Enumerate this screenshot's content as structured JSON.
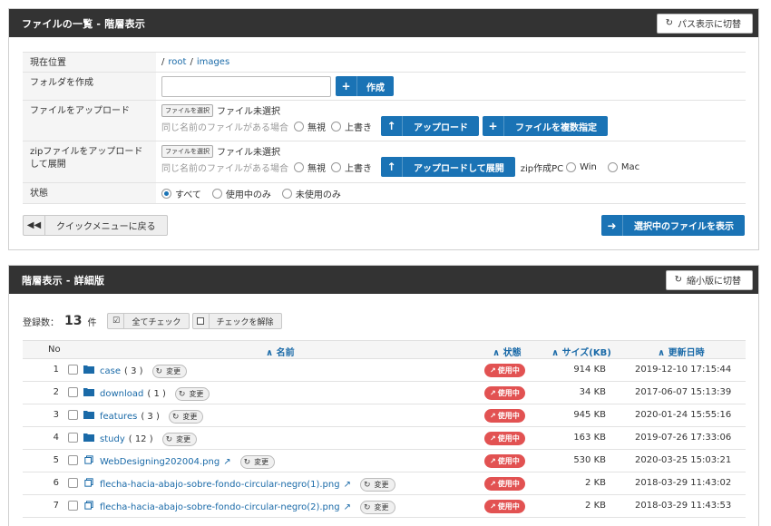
{
  "panel1": {
    "title": "ファイルの一覧 - 階層表示",
    "switch_label": "パス表示に切替",
    "rows": {
      "location_label": "現在位置",
      "location_root": "root",
      "location_sep": "/",
      "location_dir": "images",
      "folder_label": "フォルダを作成",
      "folder_create": "作成",
      "upload_label": "ファイルをアップロード",
      "file_select": "ファイルを選択",
      "file_none": "ファイル未選択",
      "same_name": "同じ名前のファイルがある場合",
      "ignore": "無視",
      "overwrite": "上書き",
      "upload_btn": "アップロード",
      "multi_btn": "ファイルを複数指定",
      "zip_label": "zipファイルをアップロードして展開",
      "zip_btn": "アップロードして展開",
      "zip_pc": "zip作成PC",
      "win": "Win",
      "mac": "Mac",
      "state_label": "状態",
      "state_all": "すべて",
      "state_used": "使用中のみ",
      "state_unused": "未使用のみ"
    },
    "back_btn": "クイックメニューに戻る",
    "show_selected_btn": "選択中のファイルを表示"
  },
  "panel2": {
    "title": "階層表示 - 詳細版",
    "switch_label": "縮小版に切替",
    "count_label": "登録数：",
    "count_value": "13",
    "count_unit": "件",
    "check_all": "全てチェック",
    "uncheck": "チェックを解除",
    "headers": {
      "no": "No",
      "name": "名前",
      "state": "状態",
      "size": "サイズ(KB)",
      "date": "更新日時"
    },
    "change_label": "変更",
    "in_use": "使用中",
    "files": [
      {
        "no": "1",
        "name": "case",
        "count": "( 3 )",
        "type": "folder",
        "size": "914 KB",
        "date": "2019-12-10 17:15:44"
      },
      {
        "no": "2",
        "name": "download",
        "count": "( 1 )",
        "type": "folder",
        "size": "34 KB",
        "date": "2017-06-07 15:13:39"
      },
      {
        "no": "3",
        "name": "features",
        "count": "( 3 )",
        "type": "folder",
        "size": "945 KB",
        "date": "2020-01-24 15:55:16"
      },
      {
        "no": "4",
        "name": "study",
        "count": "( 12 )",
        "type": "folder",
        "size": "163 KB",
        "date": "2019-07-26 17:33:06"
      },
      {
        "no": "5",
        "name": "WebDesigning202004.png",
        "count": "",
        "type": "file",
        "size": "530 KB",
        "date": "2020-03-25 15:03:21"
      },
      {
        "no": "6",
        "name": "flecha-hacia-abajo-sobre-fondo-circular-negro(1).png",
        "count": "",
        "type": "file",
        "size": "2 KB",
        "date": "2018-03-29 11:43:02"
      },
      {
        "no": "7",
        "name": "flecha-hacia-abajo-sobre-fondo-circular-negro(2).png",
        "count": "",
        "type": "file",
        "size": "2 KB",
        "date": "2018-03-29 11:43:53"
      }
    ]
  },
  "colors": {
    "header_bg": "#333333",
    "accent": "#1a73b5",
    "badge": "#e25252",
    "link": "#1a6aa8"
  }
}
